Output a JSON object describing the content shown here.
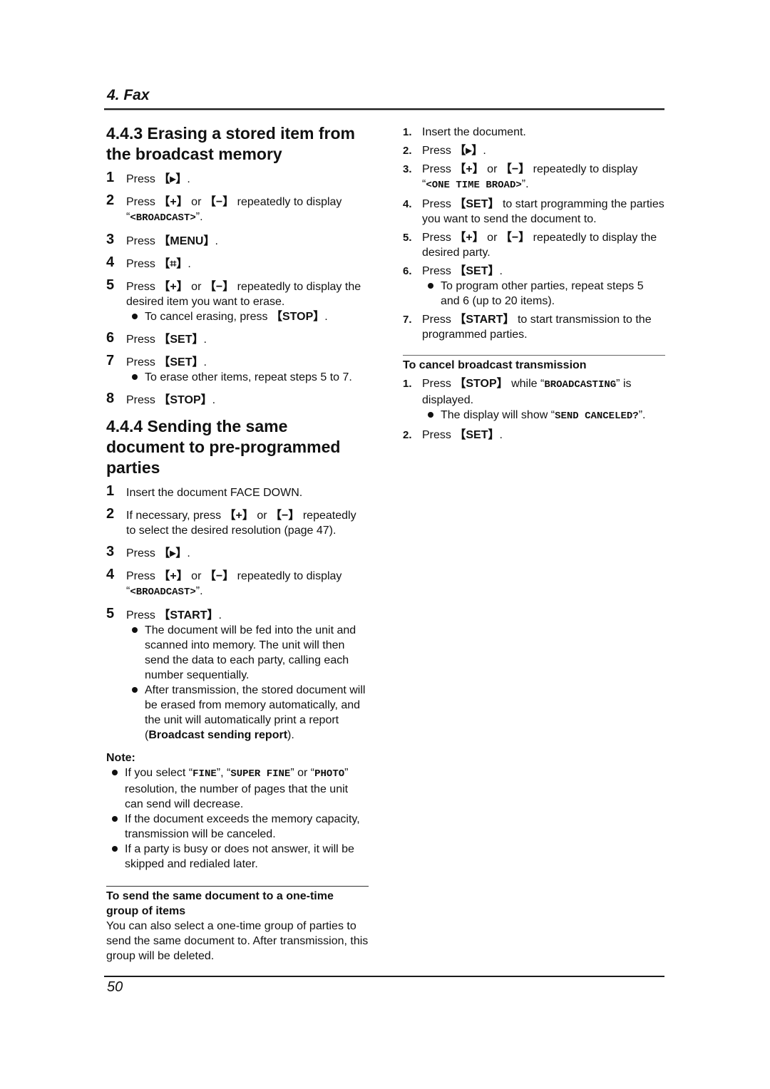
{
  "header": {
    "chapter": "4. Fax"
  },
  "footer": {
    "page_number": "50"
  },
  "keys": {
    "right": "▸",
    "plus": "+",
    "minus": "−",
    "hash": "⌗",
    "menu": "MENU",
    "stop": "STOP",
    "set": "SET",
    "start": "START",
    "bracket_open": "【",
    "bracket_close": "】"
  },
  "section_443": {
    "title": "4.4.3 Erasing a stored item from the broadcast memory",
    "steps": [
      {
        "num": "1",
        "pre": "Press ",
        "post": "."
      },
      {
        "num": "2",
        "pre": "Press ",
        "mid": " or ",
        "post": " repeatedly to display",
        "display_open": "“",
        "display": "<BROADCAST>",
        "display_close": "”."
      },
      {
        "num": "3",
        "pre": "Press ",
        "post": "."
      },
      {
        "num": "4",
        "pre": "Press ",
        "post": "."
      },
      {
        "num": "5",
        "pre": "Press ",
        "mid": " or ",
        "post": " repeatedly to display the desired item you want to erase.",
        "bullet_pre": "To cancel erasing, press ",
        "bullet_post": "."
      },
      {
        "num": "6",
        "pre": "Press ",
        "post": "."
      },
      {
        "num": "7",
        "pre": "Press ",
        "post": ".",
        "bullet": "To erase other items, repeat steps 5 to 7."
      },
      {
        "num": "8",
        "pre": "Press ",
        "post": "."
      }
    ]
  },
  "section_444": {
    "title": "4.4.4 Sending the same document to pre-programmed parties",
    "steps": [
      {
        "num": "1",
        "text": "Insert the document FACE DOWN."
      },
      {
        "num": "2",
        "pre": "If necessary, press ",
        "mid": " or ",
        "post": " repeatedly to select the desired resolution (page 47)."
      },
      {
        "num": "3",
        "pre": "Press ",
        "post": "."
      },
      {
        "num": "4",
        "pre": "Press ",
        "mid": " or ",
        "post": " repeatedly to display",
        "display_open": "“",
        "display": "<BROADCAST>",
        "display_close": "”."
      },
      {
        "num": "5",
        "pre": "Press ",
        "post": ".",
        "bullet1": "The document will be fed into the unit and scanned into memory. The unit will then send the data to each party, calling each number sequentially.",
        "bullet2_pre": "After transmission, the stored document will be erased from memory automatically, and the unit will automatically print a report (",
        "bullet2_bold": "Broadcast sending report",
        "bullet2_post": ")."
      }
    ],
    "note": {
      "title": "Note:",
      "items": [
        {
          "pre": "If you select “",
          "m1": "FINE",
          "mid1": "”, “",
          "m2": "SUPER FINE",
          "mid2": "” or “",
          "m3": "PHOTO",
          "post": "” resolution, the number of pages that the unit can send will decrease."
        },
        {
          "text": "If the document exceeds the memory capacity, transmission will be canceled."
        },
        {
          "text": "If a party is busy or does not answer, it will be skipped and redialed later."
        }
      ]
    },
    "one_time": {
      "title": "To send the same document to a one-time group of items",
      "body": "You can also select a one-time group of parties to send the same document to. After transmission, this group will be deleted."
    }
  },
  "right_column": {
    "steps": [
      {
        "num": "1.",
        "text": "Insert the document."
      },
      {
        "num": "2.",
        "pre": "Press ",
        "post": "."
      },
      {
        "num": "3.",
        "pre": "Press ",
        "mid": " or ",
        "post": " repeatedly to display",
        "display_open": "“",
        "display": "<ONE TIME BROAD>",
        "display_close": "”."
      },
      {
        "num": "4.",
        "pre": "Press ",
        "post": " to start programming the parties you want to send the document to."
      },
      {
        "num": "5.",
        "pre": "Press ",
        "mid": " or ",
        "post": " repeatedly to display the desired party."
      },
      {
        "num": "6.",
        "pre": "Press ",
        "post": ".",
        "bullet": "To program other parties, repeat steps 5 and 6 (up to 20 items)."
      },
      {
        "num": "7.",
        "pre": "Press ",
        "post": " to start transmission to the programmed parties."
      }
    ],
    "cancel": {
      "title": "To cancel broadcast transmission",
      "steps": [
        {
          "num": "1.",
          "pre": "Press ",
          "mid": " while “",
          "display": "BROADCASTING",
          "post": "” is displayed.",
          "bullet_pre": "The display will show “",
          "bullet_display": "SEND CANCELED?",
          "bullet_post": "”."
        },
        {
          "num": "2.",
          "pre": "Press ",
          "post": "."
        }
      ]
    }
  }
}
